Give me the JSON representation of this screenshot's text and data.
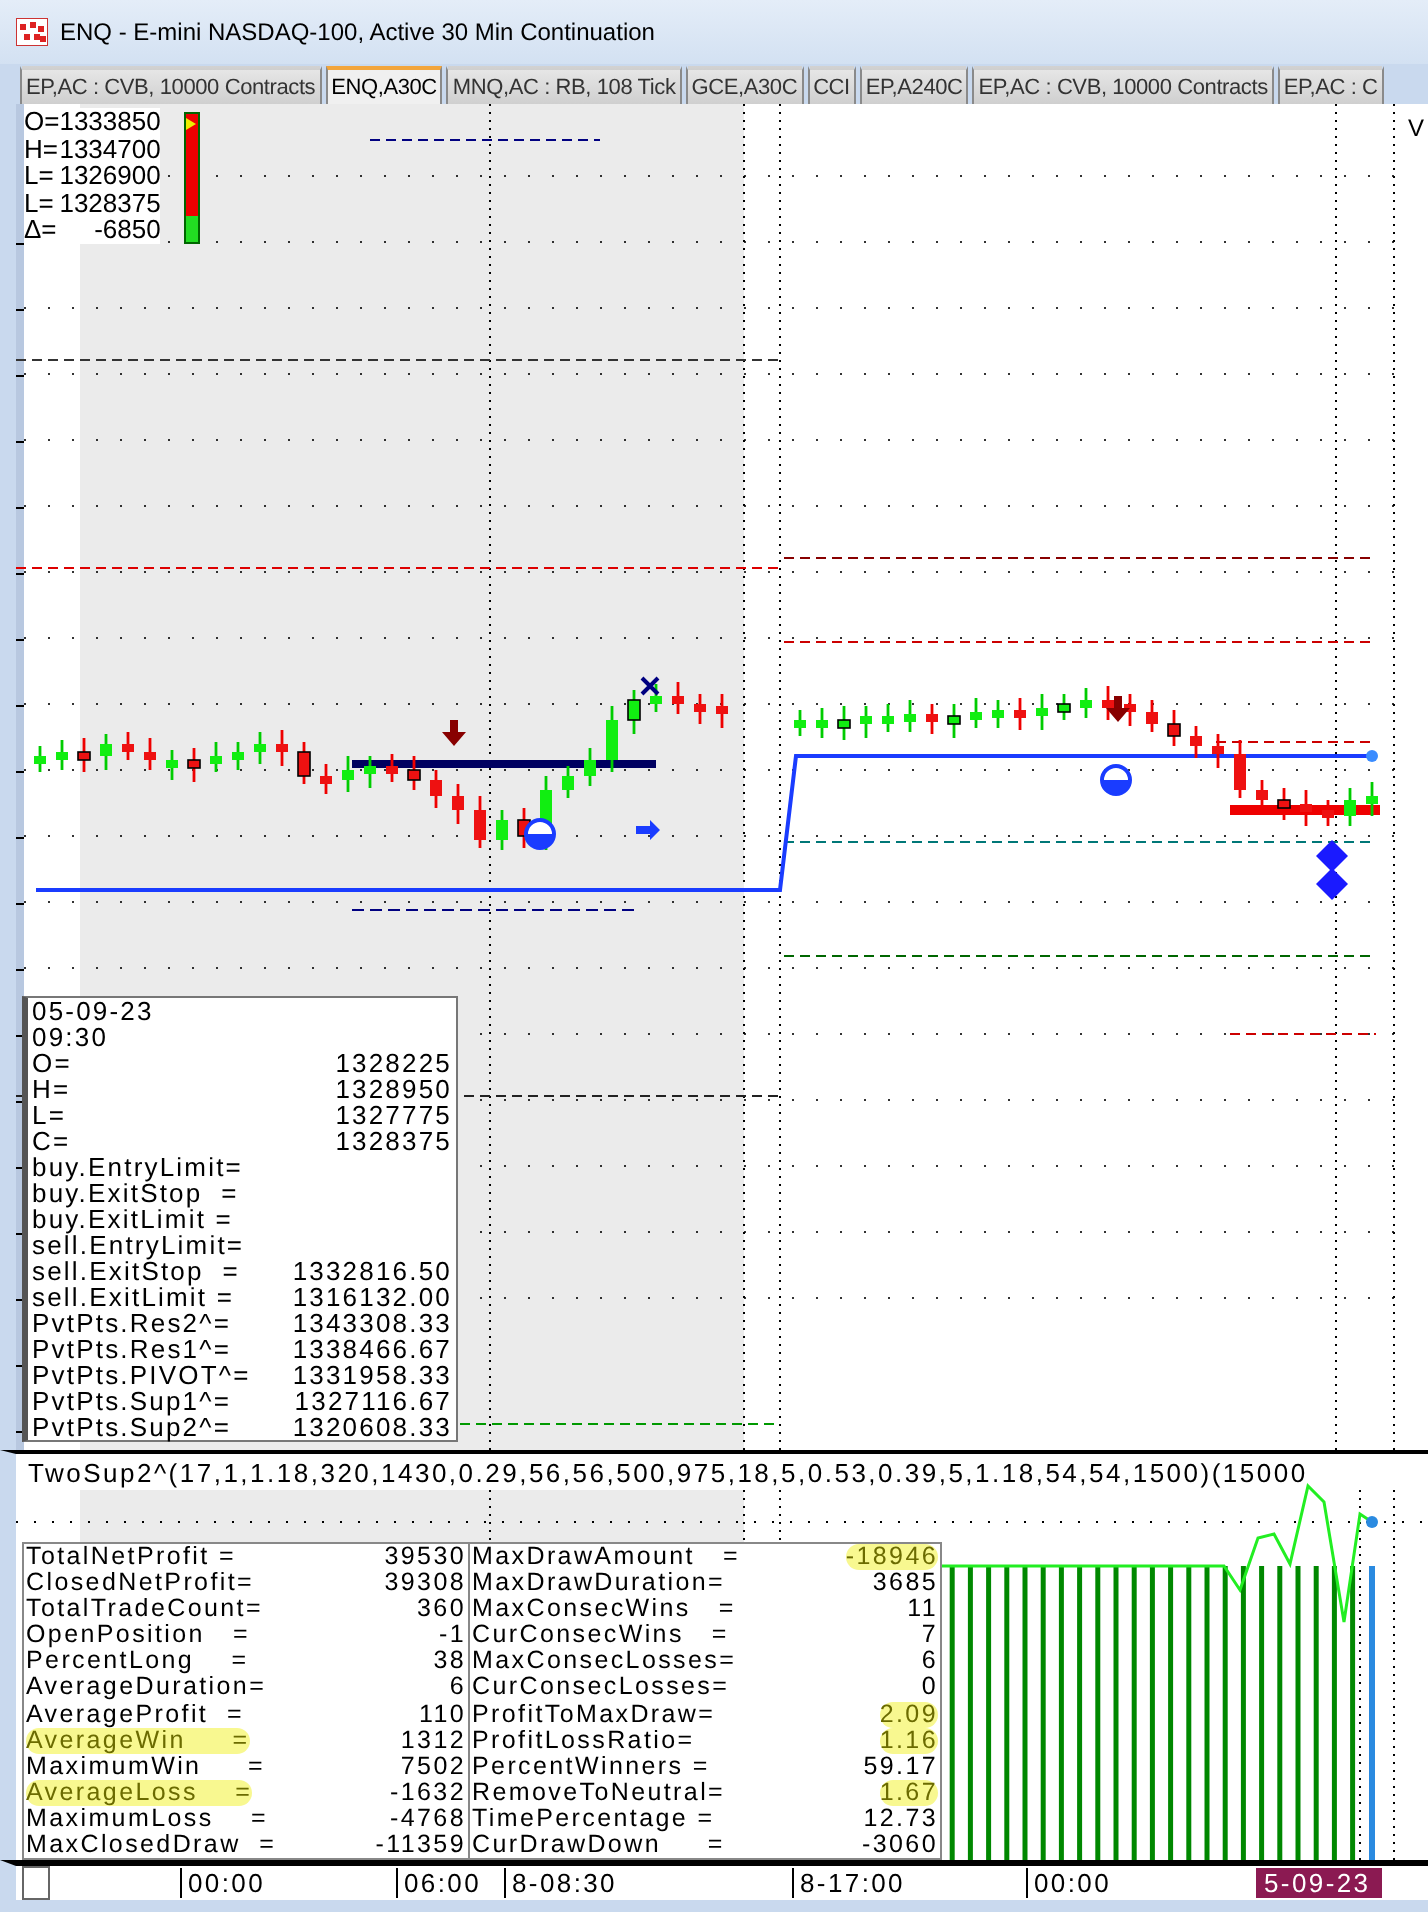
{
  "window": {
    "title": "ENQ - E-mini NASDAQ-100, Active 30 Min Continuation"
  },
  "tabs": [
    {
      "label": "EP,AC : CVB, 10000 Contracts",
      "selected": false
    },
    {
      "label": "ENQ,A30C",
      "selected": true
    },
    {
      "label": "MNQ,AC : RB, 108 Tick",
      "selected": false
    },
    {
      "label": "GCE,A30C",
      "selected": false
    },
    {
      "label": "CCI",
      "selected": false
    },
    {
      "label": "EP,A240C",
      "selected": false
    },
    {
      "label": "EP,AC : CVB, 10000 Contracts",
      "selected": false
    },
    {
      "label": "EP,AC : C",
      "selected": false
    }
  ],
  "price_legend": [
    {
      "label": "O=",
      "value": "1333850"
    },
    {
      "label": "H=",
      "value": "1334700"
    },
    {
      "label": "L=",
      "value": "1326900"
    },
    {
      "label": "L=",
      "value": "1328375"
    },
    {
      "label": "Δ=",
      "value": "-6850"
    }
  ],
  "edge_label": "V",
  "data_window": {
    "date": "05-09-23",
    "time": "09:30",
    "rows": [
      {
        "label": "O=",
        "value": "1328225"
      },
      {
        "label": "H=",
        "value": "1328950"
      },
      {
        "label": "L=",
        "value": "1327775"
      },
      {
        "label": "C=",
        "value": "1328375"
      },
      {
        "label": "buy.EntryLimit=",
        "value": ""
      },
      {
        "label": "buy.ExitStop  =",
        "value": ""
      },
      {
        "label": "buy.ExitLimit =",
        "value": ""
      },
      {
        "label": "sell.EntryLimit=",
        "value": ""
      },
      {
        "label": "sell.ExitStop  =",
        "value": "1332816.50"
      },
      {
        "label": "sell.ExitLimit =",
        "value": "1316132.00"
      },
      {
        "label": "PvtPts.Res2^=",
        "value": "1343308.33"
      },
      {
        "label": "PvtPts.Res1^=",
        "value": "1338466.67"
      },
      {
        "label": "PvtPts.PIVOT^=",
        "value": "1331958.33"
      },
      {
        "label": "PvtPts.Sup1^=",
        "value": "1327116.67"
      },
      {
        "label": "PvtPts.Sup2^=",
        "value": "1320608.33"
      }
    ]
  },
  "indicator": {
    "title": "TwoSup2^(17,1,1.18,320,1430,0.29,56,56,500,975,18,5,0.53,0.39,5,1.18,54,54,1500)(15000"
  },
  "stats": {
    "left": [
      {
        "label": "TotalNetProfit =",
        "value": "39530",
        "label_highlighted": false,
        "value_highlighted": false
      },
      {
        "label": "ClosedNetProfit=",
        "value": "39308",
        "label_highlighted": false,
        "value_highlighted": false
      },
      {
        "label": "TotalTradeCount=",
        "value": "360",
        "label_highlighted": false,
        "value_highlighted": false
      },
      {
        "label": "OpenPosition   =",
        "value": "-1",
        "label_highlighted": false,
        "value_highlighted": false
      },
      {
        "label": "PercentLong    =",
        "value": "38",
        "label_highlighted": false,
        "value_highlighted": false
      },
      {
        "label": "AverageDuration=",
        "value": "6",
        "label_highlighted": false,
        "value_highlighted": false
      },
      {
        "label": "AverageProfit  =",
        "value": "110",
        "label_highlighted": false,
        "value_highlighted": false
      },
      {
        "label": "AverageWin     =",
        "value": "1312",
        "label_highlighted": true,
        "value_highlighted": false
      },
      {
        "label": "MaximumWin     =",
        "value": "7502",
        "label_highlighted": false,
        "value_highlighted": false
      },
      {
        "label": "AverageLoss    =",
        "value": "-1632",
        "label_highlighted": true,
        "value_highlighted": false
      },
      {
        "label": "MaximumLoss    =",
        "value": "-4768",
        "label_highlighted": false,
        "value_highlighted": false
      },
      {
        "label": "MaxClosedDraw  =",
        "value": "-11359",
        "label_highlighted": false,
        "value_highlighted": false
      }
    ],
    "right": [
      {
        "label": "MaxDrawAmount   =",
        "value": "-18946",
        "label_highlighted": false,
        "value_highlighted": true
      },
      {
        "label": "MaxDrawDuration=",
        "value": "3685",
        "label_highlighted": false,
        "value_highlighted": false
      },
      {
        "label": "MaxConsecWins   =",
        "value": "11",
        "label_highlighted": false,
        "value_highlighted": false
      },
      {
        "label": "CurConsecWins   =",
        "value": "7",
        "label_highlighted": false,
        "value_highlighted": false
      },
      {
        "label": "MaxConsecLosses=",
        "value": "6",
        "label_highlighted": false,
        "value_highlighted": false
      },
      {
        "label": "CurConsecLosses=",
        "value": "0",
        "label_highlighted": false,
        "value_highlighted": false
      },
      {
        "label": "ProfitToMaxDraw=",
        "value": "2.09",
        "label_highlighted": false,
        "value_highlighted": true
      },
      {
        "label": "ProfitLossRatio=",
        "value": "1.16",
        "label_highlighted": false,
        "value_highlighted": true
      },
      {
        "label": "PercentWinners =",
        "value": "59.17",
        "label_highlighted": false,
        "value_highlighted": false
      },
      {
        "label": "RemoveToNeutral=",
        "value": "1.67",
        "label_highlighted": false,
        "value_highlighted": true
      },
      {
        "label": "TimePercentage =",
        "value": "12.73",
        "label_highlighted": false,
        "value_highlighted": false
      },
      {
        "label": "CurDrawDown     =",
        "value": "-3060",
        "label_highlighted": false,
        "value_highlighted": false
      }
    ]
  },
  "time_axis": [
    {
      "label": "00:00"
    },
    {
      "label": "06:00"
    },
    {
      "label": "8-08:30"
    },
    {
      "label": "8-17:00"
    },
    {
      "label": "00:00"
    }
  ],
  "date_marker": "5-09-23"
}
